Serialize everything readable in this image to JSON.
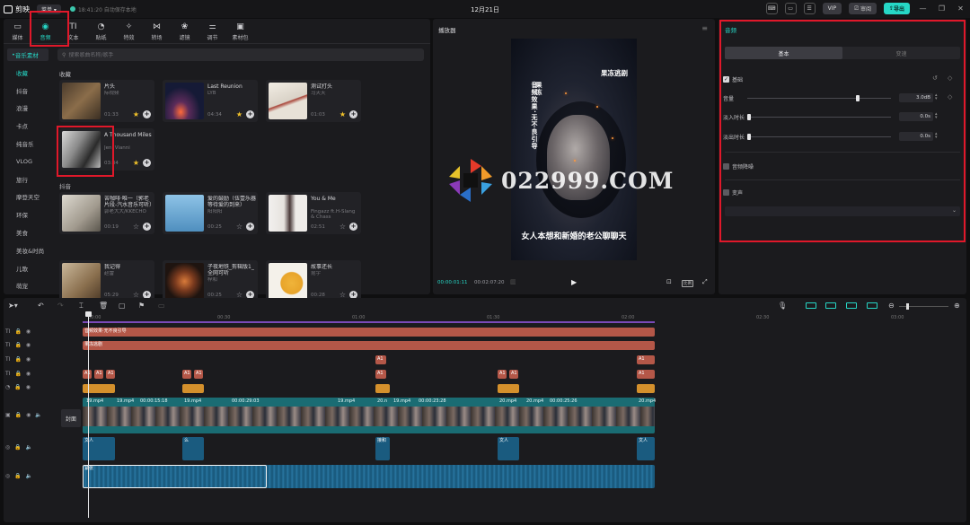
{
  "app": {
    "name": "剪映",
    "menu_label": "菜单",
    "saved_text": "18:41:20 自动保存本地",
    "project_title": "12月21日",
    "vip_label": "VIP",
    "review_label": "审阅",
    "export_label": "导出"
  },
  "media_tabs": [
    {
      "label": "媒体",
      "icon": "media-icon"
    },
    {
      "label": "音频",
      "icon": "audio-icon"
    },
    {
      "label": "文本",
      "icon": "text-icon"
    },
    {
      "label": "贴纸",
      "icon": "sticker-icon"
    },
    {
      "label": "特效",
      "icon": "effects-icon"
    },
    {
      "label": "转场",
      "icon": "transition-icon"
    },
    {
      "label": "滤镜",
      "icon": "filter-icon"
    },
    {
      "label": "调节",
      "icon": "adjust-icon"
    },
    {
      "label": "素材包",
      "icon": "package-icon"
    }
  ],
  "categories": {
    "header": "音乐素材",
    "items": [
      "收藏",
      "抖音",
      "浪漫",
      "卡点",
      "纯音乐",
      "VLOG",
      "旅行",
      "摩登天空",
      "环保",
      "美食",
      "美妆&时尚",
      "儿歌",
      "萌宠"
    ]
  },
  "search": {
    "placeholder": "搜索歌曲名称/歌手"
  },
  "favorites_label": "收藏",
  "douyin_label": "抖音",
  "music_cards": [
    {
      "title": "片头",
      "artist": "际视频",
      "duration": "01:33",
      "starred": true
    },
    {
      "title": "Last Reunion",
      "artist": "LYB",
      "duration": "04:34",
      "starred": true
    },
    {
      "title": "测试打头",
      "artist": "马天天",
      "duration": "01:03",
      "starred": true
    },
    {
      "title": "A Thousand Miles",
      "artist": "Jeni Vianni",
      "duration": "03:34",
      "starred": true
    },
    {
      "title": "苦咖啡·唯一（郭老片段-汽水音乐可听）",
      "artist": "郭老大大/KKECHO",
      "duration": "00:19",
      "starred": false
    },
    {
      "title": "爱的鼓励（伍壹乐器等待爱的到来）",
      "artist": "阳阳阳",
      "duration": "00:25",
      "starred": false
    },
    {
      "title": "You & Me",
      "artist": "Fingazz ft.H-Slang & Chass",
      "duration": "02:51",
      "starred": false
    },
    {
      "title": "我记得",
      "artist": "赵雷",
      "duration": "05:29",
      "starred": false
    },
    {
      "title": "子夜地铁_剪辑版1_全网可听",
      "artist": "梓和",
      "duration": "00:25",
      "starred": false
    },
    {
      "title": "故事还长",
      "artist": "昆宇",
      "duration": "00:28",
      "starred": false
    }
  ],
  "player": {
    "title": "播放器",
    "current_time": "00:00:01:11",
    "total_time": "00:02:07:20",
    "ratio_label": "比例",
    "video_text_vertical_1": "音频效果·无不良引导",
    "video_text_vertical_2": "果冻",
    "video_text_top": "果冻逃剧",
    "video_subtitle": "女人本想和新婚的老公聊聊天"
  },
  "watermark_text": "022999.COM",
  "properties": {
    "title": "音频",
    "tab_basic": "基本",
    "tab_speed": "变速",
    "basic_label": "基础",
    "volume_label": "音量",
    "volume_value": "3.0dB",
    "volume_level": 0.77,
    "fade_in_label": "淡入时长",
    "fade_in_value": "0.0s",
    "fade_out_label": "淡出时长",
    "fade_out_value": "0.0s",
    "denoise_label": "音频降噪",
    "voice_change_label": "变声"
  },
  "timeline": {
    "ruler": [
      "00:00",
      "00:30",
      "01:00",
      "01:30",
      "02:00",
      "02:30",
      "03:00"
    ],
    "cover_label": "封面",
    "text_track_1": "音频效果·无不良引导",
    "text_track_2": "果冻逃剧",
    "video_labels": [
      "19.mp4",
      "19.mp4",
      "00:00:15:18",
      "19.mp4",
      "00:00:29:03",
      "19.mp4",
      "20.n",
      "19.mp4",
      "00:00:23:28",
      "20.mp4",
      "20.mp4",
      "00:00:25:26",
      "20.mp4"
    ],
    "audio_label": "紧张",
    "small_clip_label": "A1",
    "voice_labels": [
      "文人",
      "文",
      "么",
      "公",
      "接和",
      "文人",
      "文人"
    ]
  },
  "colors": {
    "accent": "#26d7c6",
    "highlight": "#e0182a",
    "text_clip": "#b45748",
    "effect_clip": "#d4902c",
    "video_clip": "#21777e",
    "audio_clip": "#1a5b7f"
  }
}
